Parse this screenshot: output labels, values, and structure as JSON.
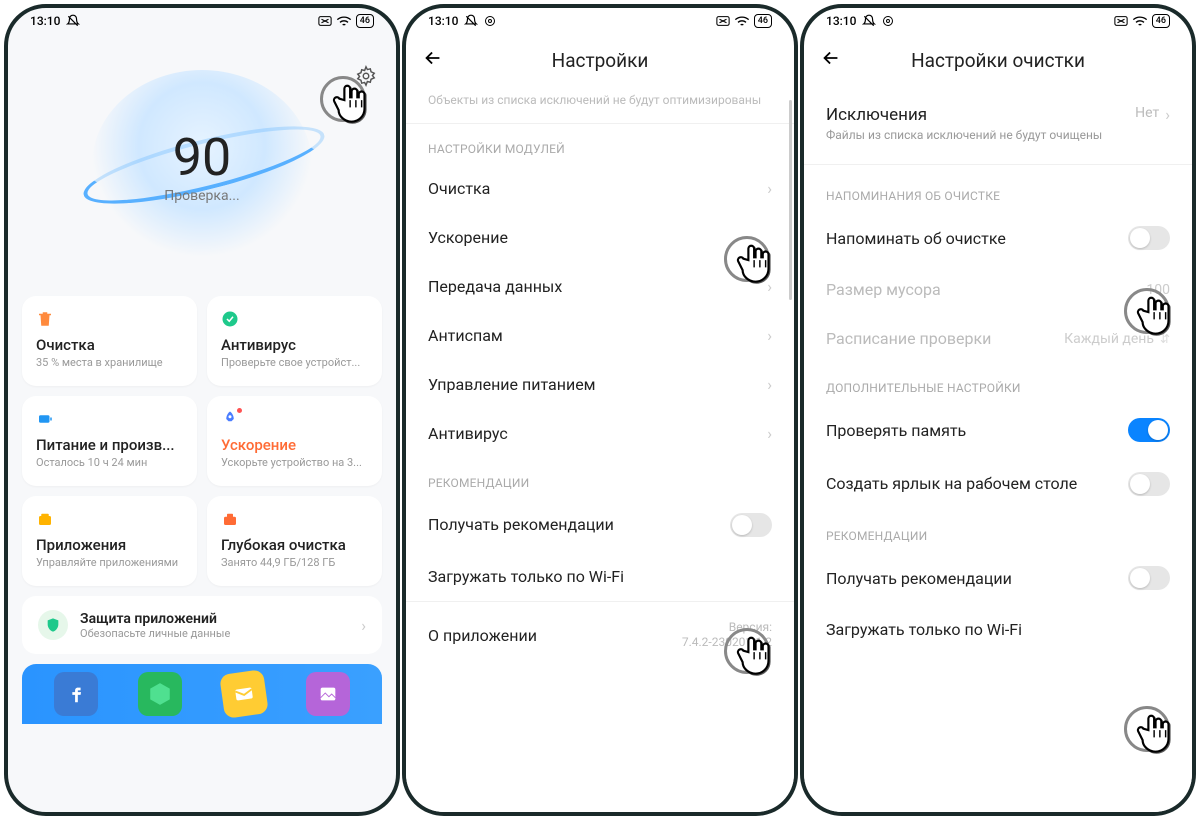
{
  "statusbar": {
    "time": "13:10",
    "battery": "46"
  },
  "phone1": {
    "score": "90",
    "score_label": "Проверка...",
    "cards": [
      {
        "title": "Очистка",
        "sub": "35 % места в хранилище",
        "icon": "trash",
        "color": "#ff8a3d"
      },
      {
        "title": "Антивирус",
        "sub": "Проверьте свое устройст...",
        "icon": "check",
        "color": "#1ec98b"
      },
      {
        "title": "Питание и произв...",
        "sub": "Осталось 10 ч 24 мин",
        "icon": "battery",
        "color": "#2196f3"
      },
      {
        "title": "Ускорение",
        "title_red": true,
        "sub": "Ускорьте устройство на 3...",
        "icon": "rocket",
        "color": "#4a7dff",
        "dot": true
      },
      {
        "title": "Приложения",
        "sub": "Управляйте приложениями",
        "icon": "apps",
        "color": "#ffb300"
      },
      {
        "title": "Глубокая очистка",
        "sub": "Занято 44,9 ГБ/128 ГБ",
        "icon": "toolbox",
        "color": "#ff6b35"
      }
    ],
    "app_protect": {
      "title": "Защита приложений",
      "sub": "Обезопасьте личные данные"
    }
  },
  "phone2": {
    "title": "Настройки",
    "truncated_note": "Объекты из списка исключений не будут оптимизированы",
    "sec_modules": "НАСТРОЙКИ МОДУЛЕЙ",
    "modules": [
      {
        "label": "Очистка"
      },
      {
        "label": "Ускорение"
      },
      {
        "label": "Передача данных"
      },
      {
        "label": "Антиспам"
      },
      {
        "label": "Управление питанием"
      },
      {
        "label": "Антивирус"
      }
    ],
    "sec_rec": "РЕКОМЕНДАЦИИ",
    "rec_get": "Получать рекомендации",
    "rec_wifi": "Загружать только по Wi-Fi",
    "about_label": "О приложении",
    "version_label": "Версия:",
    "version_value": "7.4.2-230201.1.2"
  },
  "phone3": {
    "title": "Настройки очистки",
    "excl_title": "Исключения",
    "excl_sub": "Файлы из списка исключений не будут очищены",
    "excl_val": "Нет",
    "sec_remind": "НАПОМИНАНИЯ ОБ ОЧИСТКЕ",
    "remind_label": "Напоминать об очистке",
    "junk_label": "Размер мусора",
    "junk_val": "100",
    "schedule_label": "Расписание проверки",
    "schedule_val": "Каждый день",
    "sec_extra": "ДОПОЛНИТЕЛЬНЫЕ НАСТРОЙКИ",
    "check_mem": "Проверять память",
    "shortcut": "Создать ярлык на рабочем столе",
    "sec_rec": "РЕКОМЕНДАЦИИ",
    "rec_get": "Получать рекомендации",
    "rec_wifi": "Загружать только по Wi-Fi"
  }
}
